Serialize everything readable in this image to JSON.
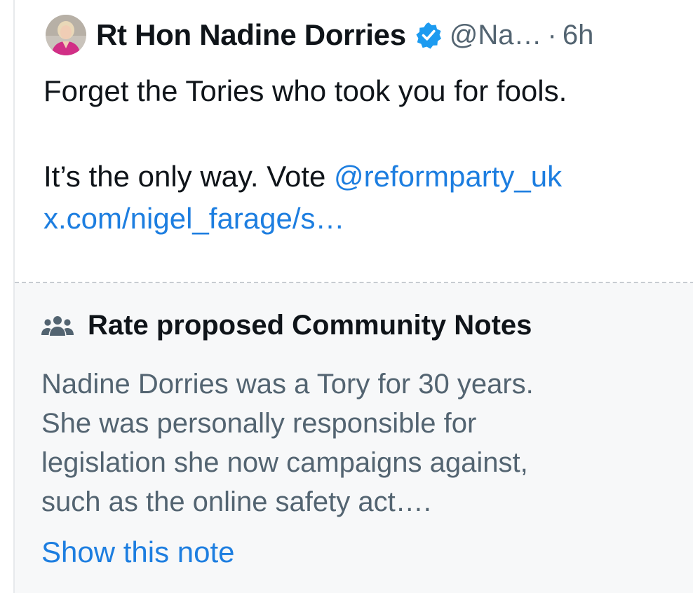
{
  "tweet": {
    "display_name": "Rt Hon Nadine Dorries",
    "handle": "@Na…",
    "separator": "·",
    "timestamp": "6h",
    "verified_icon": "verified-badge-icon",
    "text_line1": "Forget the Tories who took you for fools.",
    "text_line2_prefix": "It’s the only way.  Vote ",
    "mention": "@reformparty_uk",
    "url": "x.com/nigel_farage/s…"
  },
  "community_note": {
    "icon": "people-icon",
    "title": "Rate proposed Community Notes",
    "body_lines": [
      "Nadine Dorries was a Tory for 30 years.",
      "She was personally responsible for",
      "legislation she now campaigns against,",
      "such as the online safety act…."
    ],
    "show_label": "Show this note"
  },
  "colors": {
    "link": "#1d7ee0",
    "verified": "#1d9bf0",
    "text": "#0f1419",
    "muted": "#536471",
    "note_bg": "#f7f8f9"
  }
}
